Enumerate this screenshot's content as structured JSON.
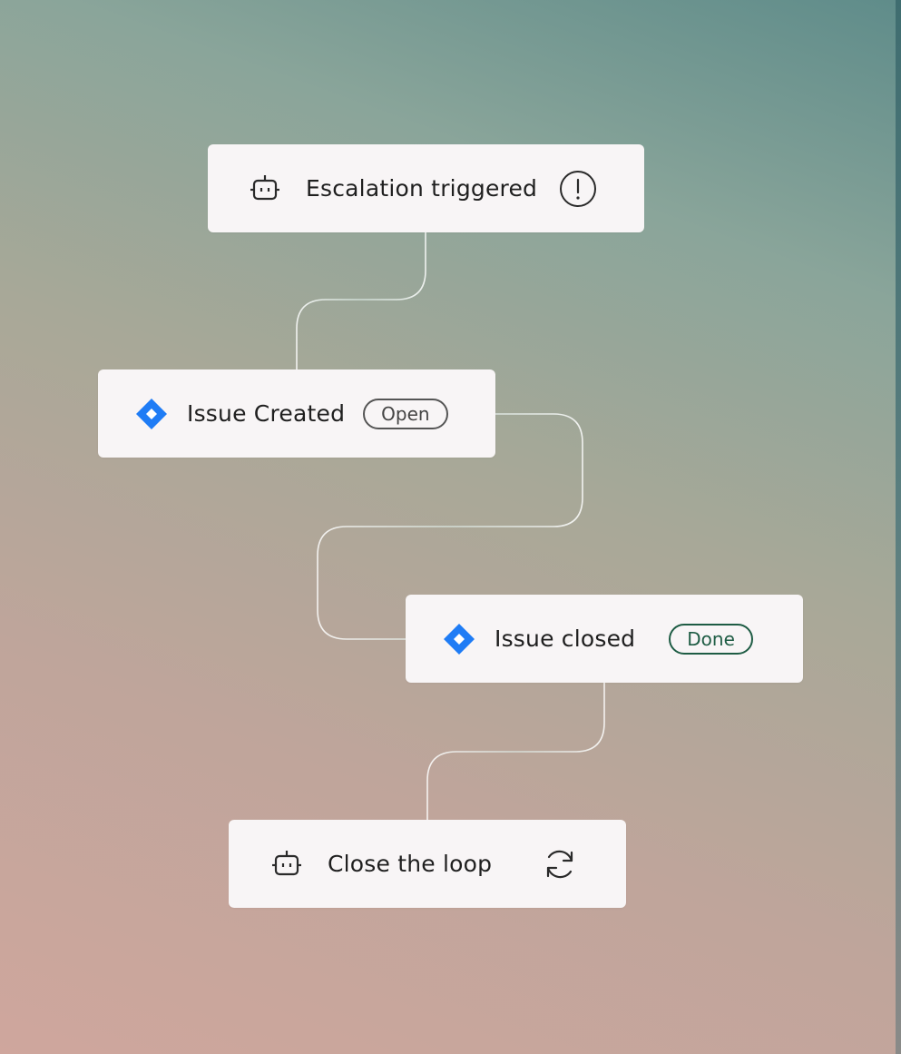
{
  "nodes": [
    {
      "id": "escalation",
      "label": "Escalation triggered",
      "leading_icon": "bot-icon",
      "trailing_icon": "alert-circle-icon"
    },
    {
      "id": "issue_created",
      "label": "Issue Created",
      "leading_icon": "jira-diamond-icon",
      "status": "Open"
    },
    {
      "id": "issue_closed",
      "label": "Issue closed",
      "leading_icon": "jira-diamond-icon",
      "status": "Done"
    },
    {
      "id": "close_loop",
      "label": "Close the loop",
      "leading_icon": "bot-icon",
      "trailing_icon": "refresh-icon"
    }
  ],
  "edges": [
    {
      "from": "escalation",
      "to": "issue_created"
    },
    {
      "from": "issue_created",
      "to": "issue_closed"
    },
    {
      "from": "issue_closed",
      "to": "close_loop"
    }
  ],
  "colors": {
    "jira_blue": "#1f7cf5",
    "done_green": "#1e5c44",
    "open_gray": "#555555",
    "card_bg": "#f8f5f6",
    "connector": "#ffffff"
  }
}
